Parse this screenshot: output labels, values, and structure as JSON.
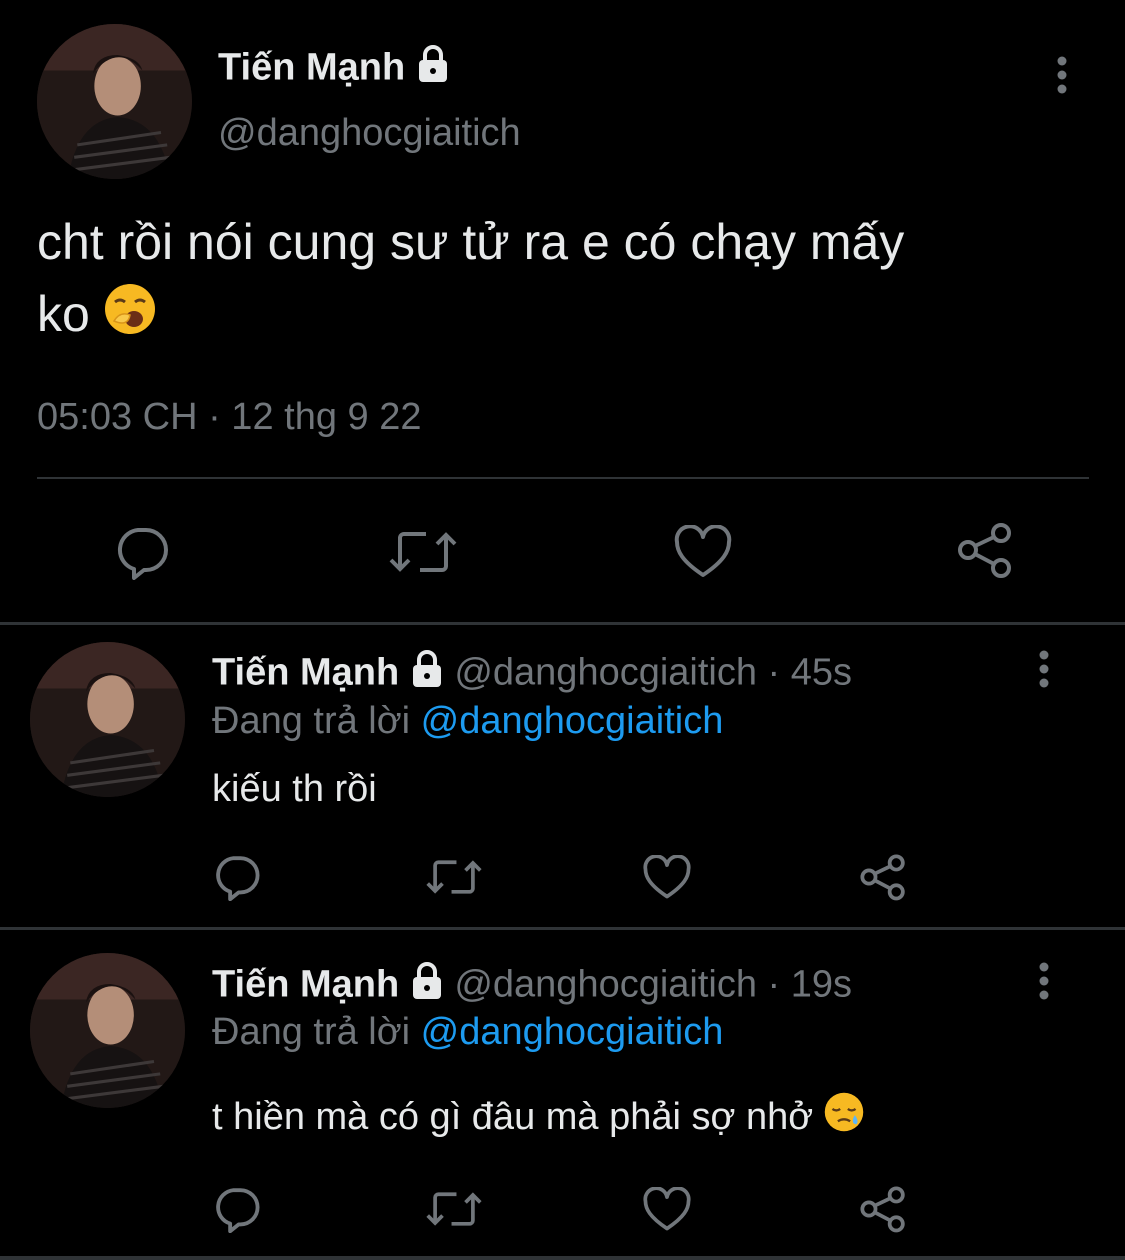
{
  "main_tweet": {
    "name": "Tiến Mạnh",
    "handle": "@danghocgiaitich",
    "text_line1": "cht rồi nói cung sư tử ra e có chạy mấy",
    "text_line2": "ko",
    "emoji": "yawning-face-emoji",
    "meta": "05:03 CH · 12 thg 9 22"
  },
  "replies": [
    {
      "name": "Tiến Mạnh",
      "handle_time": "@danghocgiaitich · 45s",
      "replying_prefix": "Đang trả lời",
      "replying_to": "@danghocgiaitich",
      "text": "kiếu th rồi"
    },
    {
      "name": "Tiến Mạnh",
      "handle_time": "@danghocgiaitich · 19s",
      "replying_prefix": "Đang trả lời",
      "replying_to": "@danghocgiaitich",
      "text": "t hiền mà có gì đâu mà phải sợ nhở",
      "emoji": "sleepy-face-emoji"
    }
  ],
  "icons": [
    "reply-icon",
    "retweet-icon",
    "like-icon",
    "share-icon",
    "lock-icon",
    "more-options-icon"
  ],
  "colors": {
    "background": "#000000",
    "text": "#e7e9ea",
    "muted": "#71767b",
    "link": "#1d9bf0",
    "divider": "#2f3336"
  }
}
